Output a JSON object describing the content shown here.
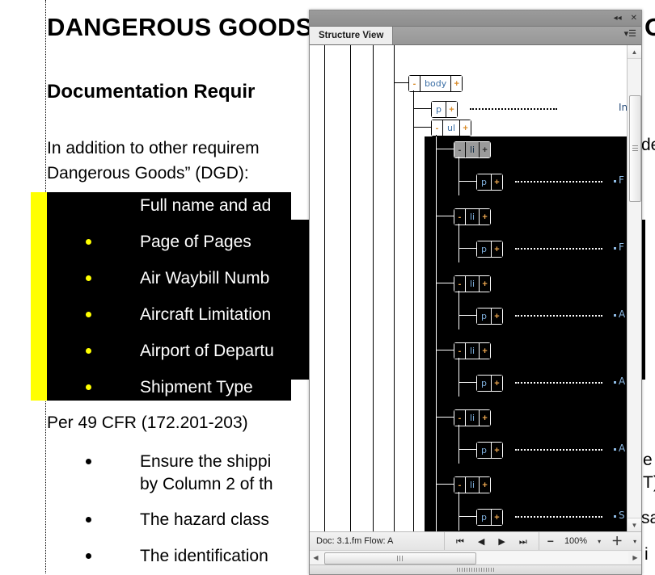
{
  "document": {
    "title": "DANGEROUS GOODS",
    "title_right_fragment": "O",
    "heading2": "Documentation Requir",
    "paragraph1_line1": "In addition to other requirem",
    "paragraph1_line2": "Dangerous Goods” (DGD):",
    "paragraph1_right_fragment": "de",
    "paragraph2": "Per 49 CFR (172.201-203)",
    "selected_list": [
      "Full name and ad",
      "Page of Pages",
      "Air Waybill Numb",
      "Aircraft Limitation",
      "Airport of Departu",
      "Shipment Type"
    ],
    "lower_list": [
      "Ensure the shippi",
      "by Column 2 of th",
      "The hazard class",
      "The identification"
    ],
    "right_edge_fragments": [
      "e",
      "T)",
      "sa",
      "i"
    ],
    "colors": {
      "highlight": "#ffff00",
      "selection_background": "#000000",
      "selection_text": "#ffffff",
      "selection_bullet": "#ffff00"
    }
  },
  "structure_view": {
    "tab_label": "Structure View",
    "titlebar_buttons": [
      {
        "name": "collapse",
        "glyph": "◂◂"
      },
      {
        "name": "close",
        "glyph": "✕"
      }
    ],
    "tab_menu_glyph": "▾☰",
    "nodes": [
      {
        "name": "body",
        "left_toggle": "-",
        "right_toggle": "+",
        "state": "normal"
      },
      {
        "name": "p",
        "left_toggle": "",
        "right_toggle": "+",
        "state": "normal"
      },
      {
        "name": "ul",
        "left_toggle": "-",
        "right_toggle": "+",
        "state": "normal"
      },
      {
        "name": "li",
        "left_toggle": "-",
        "right_toggle": "+",
        "state": "current"
      },
      {
        "name": "p",
        "left_toggle": "",
        "right_toggle": "+",
        "state": "selected"
      },
      {
        "name": "li",
        "left_toggle": "-",
        "right_toggle": "+",
        "state": "selected"
      },
      {
        "name": "p",
        "left_toggle": "",
        "right_toggle": "+",
        "state": "selected"
      },
      {
        "name": "li",
        "left_toggle": "-",
        "right_toggle": "+",
        "state": "selected"
      },
      {
        "name": "p",
        "left_toggle": "",
        "right_toggle": "+",
        "state": "selected"
      },
      {
        "name": "li",
        "left_toggle": "-",
        "right_toggle": "+",
        "state": "selected"
      },
      {
        "name": "p",
        "left_toggle": "",
        "right_toggle": "+",
        "state": "selected"
      },
      {
        "name": "li",
        "left_toggle": "-",
        "right_toggle": "+",
        "state": "selected"
      },
      {
        "name": "p",
        "left_toggle": "",
        "right_toggle": "+",
        "state": "selected"
      },
      {
        "name": "li",
        "left_toggle": "-",
        "right_toggle": "+",
        "state": "selected"
      },
      {
        "name": "p",
        "left_toggle": "",
        "right_toggle": "+",
        "state": "selected"
      }
    ],
    "snippets": [
      "In",
      "F",
      "F",
      "A",
      "A",
      "A",
      "S"
    ],
    "scrollbar": {
      "up_glyph": "▲",
      "down_glyph": "▼",
      "left_glyph": "◀",
      "right_glyph": "▶"
    }
  },
  "status_bar": {
    "doc_label": "Doc: 3.1.fm  Flow: A",
    "nav_buttons": [
      {
        "name": "first-page",
        "glyph": "⏮"
      },
      {
        "name": "previous-page",
        "glyph": "◀"
      },
      {
        "name": "next-page",
        "glyph": "▶"
      },
      {
        "name": "last-page",
        "glyph": "⏭"
      }
    ],
    "zoom_out_glyph": "−",
    "zoom_value": "100%",
    "zoom_caret": "▾",
    "zoom_in_glyph": "＋",
    "extra_caret": "▾"
  }
}
